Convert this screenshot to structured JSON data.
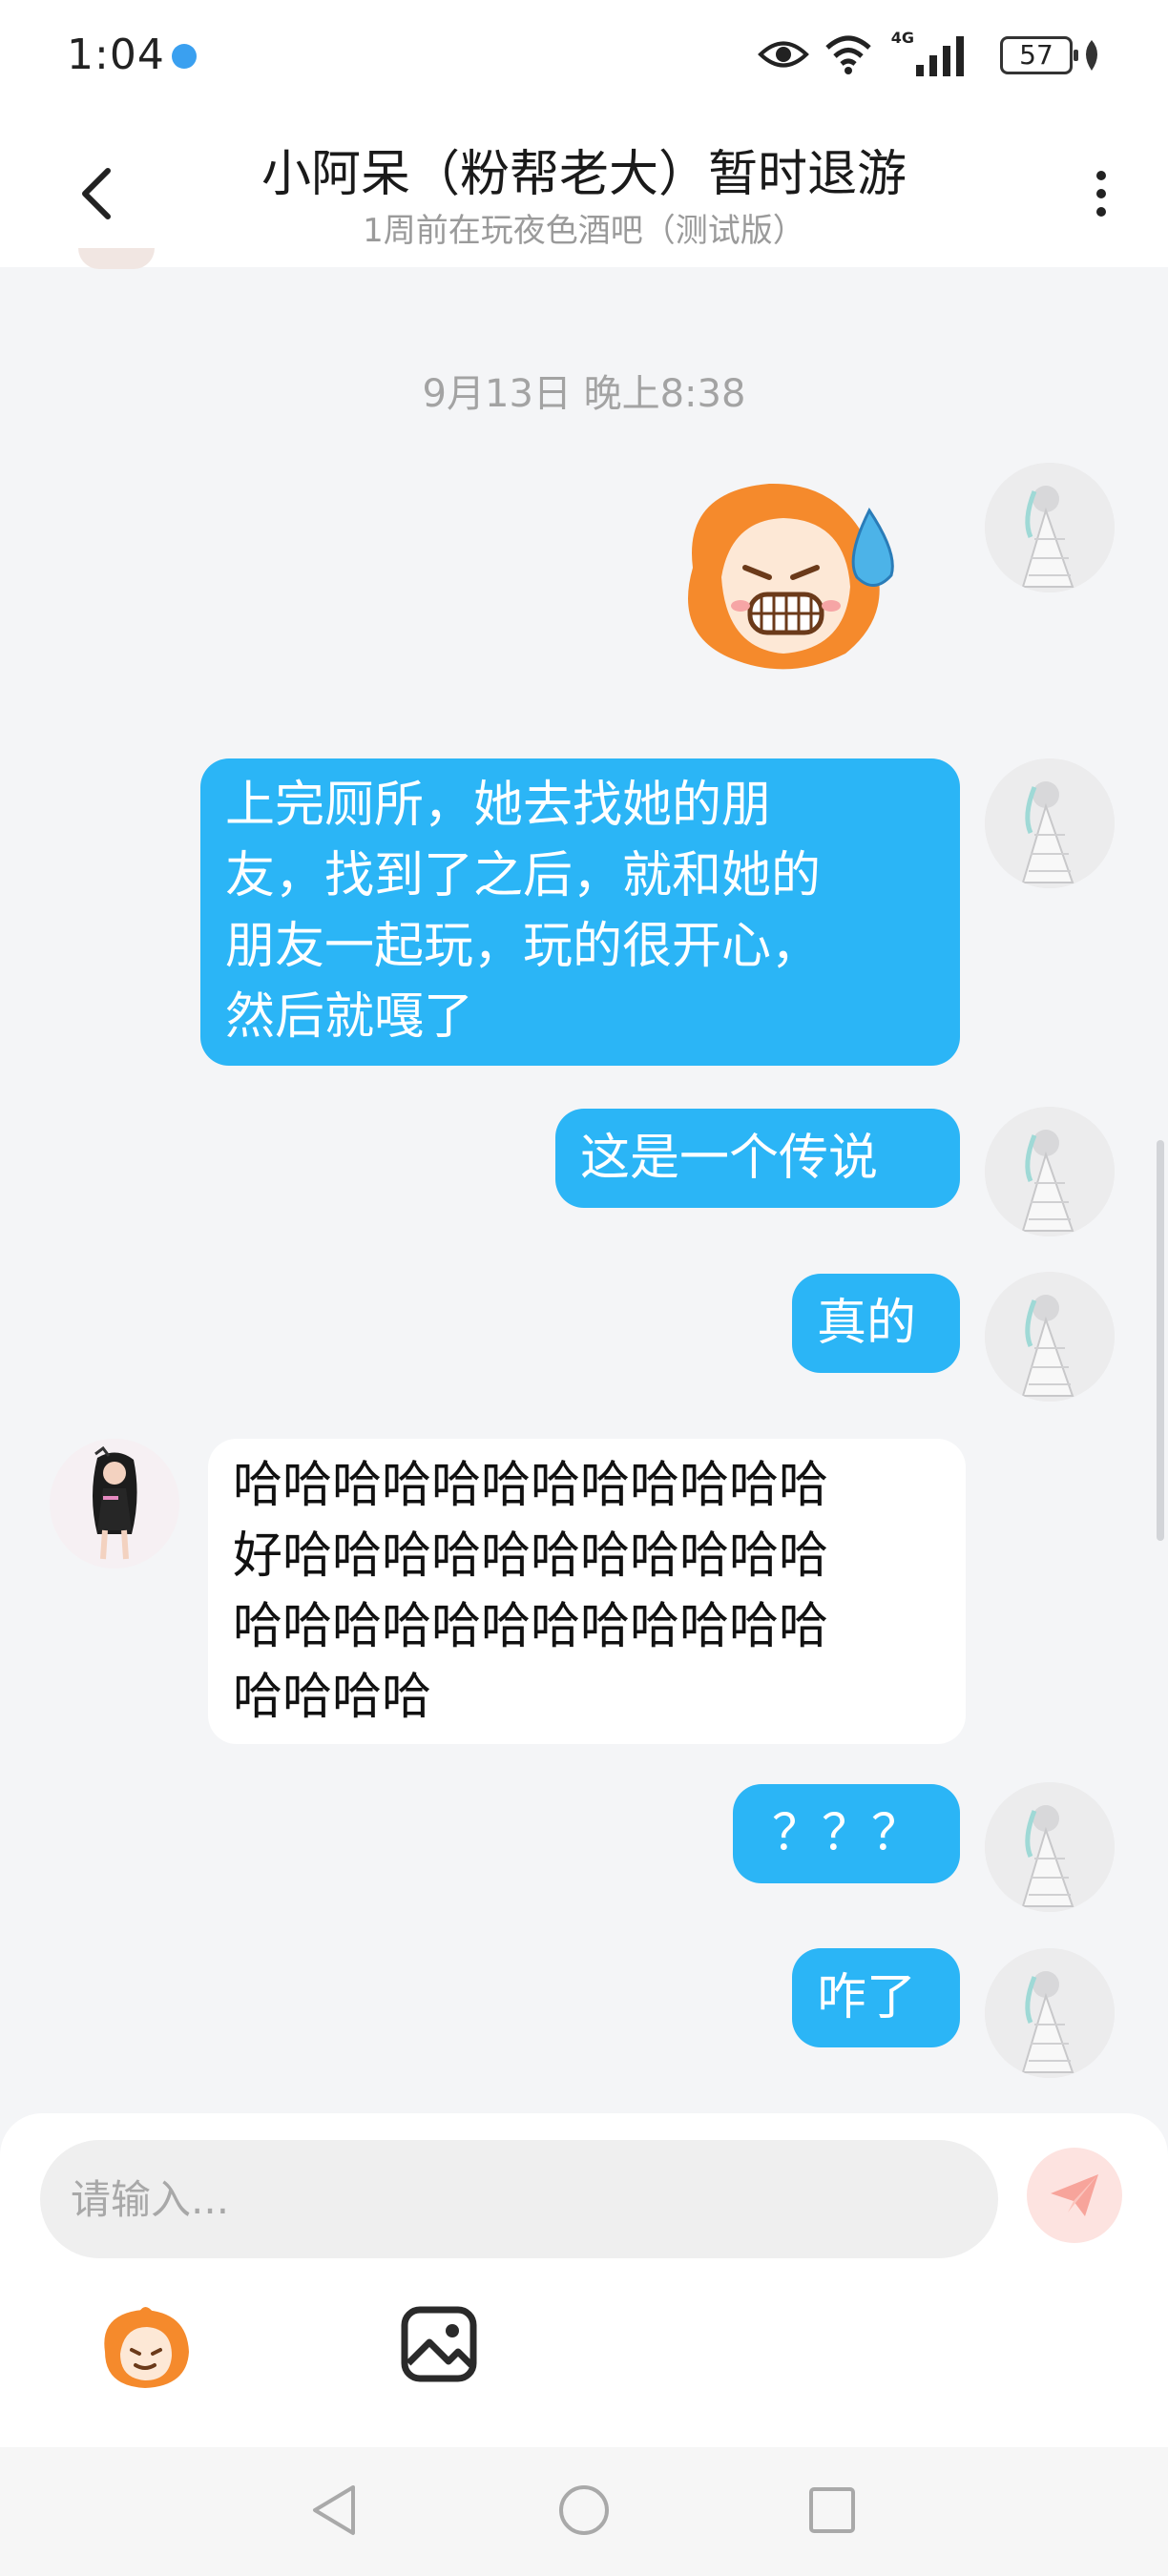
{
  "status_bar": {
    "time": "1:04",
    "network_label": "4G",
    "battery": "57"
  },
  "header": {
    "title": "小阿呆（粉帮老大）暂时退游",
    "subtitle": "1周前在玩夜色酒吧（测试版）"
  },
  "chat": {
    "timestamp": "9月13日 晚上8:38",
    "messages": [
      {
        "sender": "self",
        "type": "sticker",
        "sticker": "sweating-mascot-sticker"
      },
      {
        "sender": "self",
        "type": "text",
        "text": "上完厕所，她去找她的朋\n友，找到了之后，就和她的\n朋友一起玩，玩的很开心，\n然后就嘎了"
      },
      {
        "sender": "self",
        "type": "text",
        "text": "这是一个传说"
      },
      {
        "sender": "self",
        "type": "text",
        "text": "真的"
      },
      {
        "sender": "other",
        "type": "text",
        "text": "哈哈哈哈哈哈哈哈哈哈哈哈\n好哈哈哈哈哈哈哈哈哈哈哈\n哈哈哈哈哈哈哈哈哈哈哈哈\n哈哈哈哈"
      },
      {
        "sender": "self",
        "type": "text",
        "text": "？？？"
      },
      {
        "sender": "self",
        "type": "text",
        "text": "咋了"
      }
    ]
  },
  "input": {
    "placeholder": "请输入..."
  },
  "icons": {
    "back": "chevron-left-icon",
    "more": "more-vertical-icon",
    "send": "paper-plane-icon",
    "emoji": "mascot-emoji-icon",
    "image": "image-icon",
    "nav_back": "triangle-back-icon",
    "nav_home": "circle-home-icon",
    "nav_recents": "square-recents-icon"
  },
  "colors": {
    "self_bubble": "#2bb5f6",
    "other_bubble": "#ffffff",
    "background": "#f4f5f7",
    "send_button": "#fde3e0",
    "mascot_orange": "#f58a2c"
  }
}
